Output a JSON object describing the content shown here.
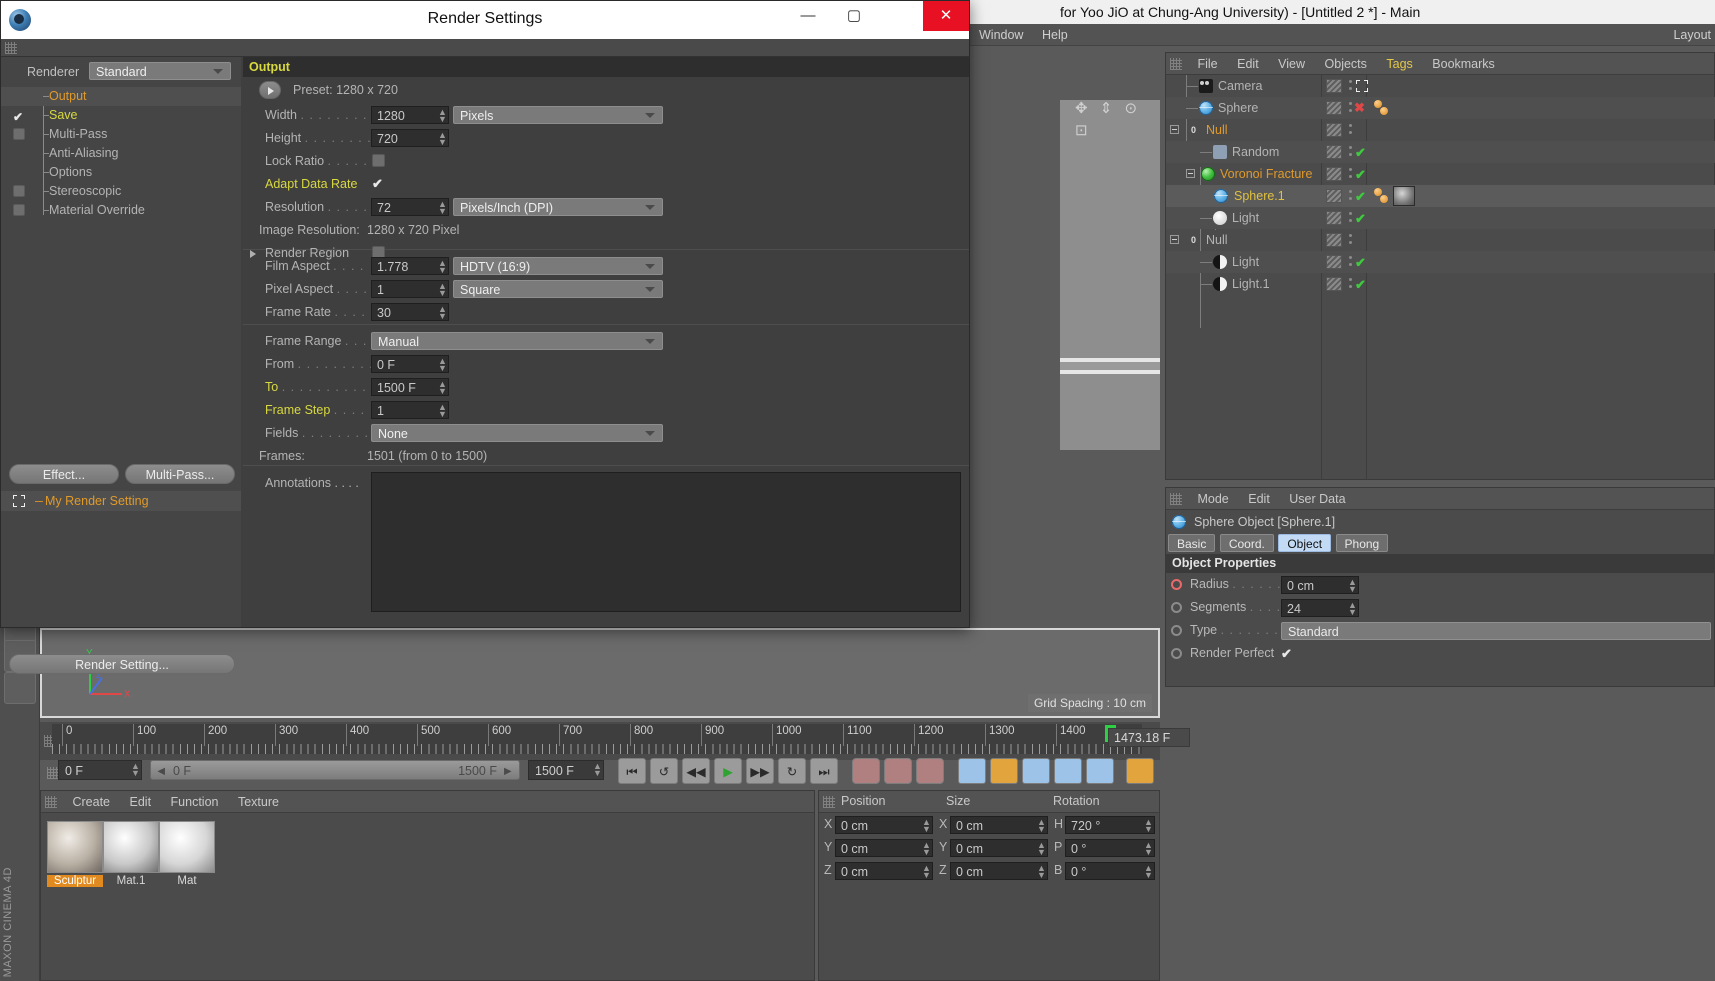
{
  "app": {
    "window_title": "for Yoo JiO at Chung-Ang University) - [Untitled 2 *] - Main",
    "menu": [
      "Window",
      "Help"
    ],
    "layout_label": "Layout"
  },
  "object_manager": {
    "menu": [
      "File",
      "Edit",
      "View",
      "Objects",
      "Tags",
      "Bookmarks"
    ],
    "highlighted_menu": "Tags",
    "rows": [
      {
        "name": "Camera",
        "icon": "camera-icon",
        "color": "gray",
        "indent": 1,
        "state": "axis",
        "materials": []
      },
      {
        "name": "Sphere",
        "icon": "sphere-icon",
        "color": "gray",
        "indent": 1,
        "state": "x",
        "materials": [
          "mat-dot",
          "mat-dot"
        ]
      },
      {
        "name": "Null",
        "icon": "null-icon",
        "color": "orange",
        "indent": 0,
        "state": "none",
        "materials": []
      },
      {
        "name": "Random",
        "icon": "random-icon",
        "color": "gray",
        "indent": 2,
        "state": "check",
        "materials": []
      },
      {
        "name": "Voronoi Fracture",
        "icon": "voronoi-icon",
        "color": "orange",
        "indent": 1,
        "state": "check",
        "materials": []
      },
      {
        "name": "Sphere.1",
        "icon": "sphere-icon",
        "color": "yellow",
        "indent": 3,
        "state": "check",
        "materials": [
          "mat-dot",
          "mat-dot",
          "mat-thumb"
        ]
      },
      {
        "name": "Light",
        "icon": "light-icon",
        "color": "gray",
        "indent": 2,
        "state": "none",
        "materials": []
      },
      {
        "name": "Null",
        "icon": "null-icon",
        "color": "gray",
        "indent": 0,
        "state": "none",
        "materials": []
      },
      {
        "name": "Light",
        "icon": "light2-icon",
        "color": "gray",
        "indent": 2,
        "state": "check",
        "materials": []
      },
      {
        "name": "Light.1",
        "icon": "light2-icon",
        "color": "gray",
        "indent": 2,
        "state": "check",
        "materials": []
      }
    ]
  },
  "attribute_manager": {
    "menu": [
      "Mode",
      "Edit",
      "User Data"
    ],
    "object_title": "Sphere Object [Sphere.1]",
    "tabs": [
      "Basic",
      "Coord.",
      "Object",
      "Phong"
    ],
    "active_tab": "Object",
    "section_title": "Object Properties",
    "props": [
      {
        "label": "Radius",
        "dots": ". . . . . .",
        "value": "0 cm",
        "type": "num",
        "radio": "on"
      },
      {
        "label": "Segments",
        "dots": ". . . .",
        "value": "24",
        "type": "num",
        "radio": "off"
      },
      {
        "label": "Type",
        "dots": ". . . . . . .",
        "value": "Standard",
        "type": "drop",
        "radio": "off"
      },
      {
        "label": "Render Perfect",
        "dots": "",
        "value": "checked",
        "type": "check",
        "radio": "off"
      }
    ]
  },
  "viewport": {
    "grid_spacing_label": "Grid Spacing : 10 cm",
    "axis_labels": {
      "x": "X",
      "y": "Y",
      "z": "Z"
    }
  },
  "timeline": {
    "tick_labels": [
      "0",
      "100",
      "200",
      "300",
      "400",
      "500",
      "600",
      "700",
      "800",
      "900",
      "1000",
      "1100",
      "1200",
      "1300",
      "1400"
    ],
    "tick_values": [
      0,
      100,
      200,
      300,
      400,
      500,
      600,
      700,
      800,
      900,
      1000,
      1100,
      1200,
      1300,
      1400
    ],
    "current_frame_marker": "147",
    "current_frame_field": "1473.18 F",
    "transport": {
      "current_frame": "0 F",
      "range_start": "0 F",
      "range_end": "1500 F",
      "preview_end": "1500 F"
    }
  },
  "material_manager": {
    "menu": [
      "Create",
      "Edit",
      "Function",
      "Texture"
    ],
    "materials": [
      {
        "name": "Sculptur",
        "selected": true
      },
      {
        "name": "Mat.1",
        "selected": false
      },
      {
        "name": "Mat",
        "selected": false
      }
    ]
  },
  "coordinate_manager": {
    "headers": [
      "Position",
      "Size",
      "Rotation"
    ],
    "rows": [
      {
        "axis1": "X",
        "pos": "0 cm",
        "axis2": "X",
        "size": "0 cm",
        "axis3": "H",
        "rot": "720 °"
      },
      {
        "axis1": "Y",
        "pos": "0 cm",
        "axis2": "Y",
        "size": "0 cm",
        "axis3": "P",
        "rot": "0 °"
      },
      {
        "axis1": "Z",
        "pos": "0 cm",
        "axis2": "Z",
        "size": "0 cm",
        "axis3": "B",
        "rot": "0 °"
      }
    ]
  },
  "render_settings": {
    "window_title": "Render Settings",
    "window_buttons": {
      "minimize": "—",
      "maximize": "▢",
      "close": "✕"
    },
    "renderer_label": "Renderer",
    "renderer_value": "Standard",
    "tree": [
      {
        "label": "Output",
        "color": "orange",
        "box": "none"
      },
      {
        "label": "Save",
        "color": "yellow",
        "box": "check"
      },
      {
        "label": "Multi-Pass",
        "color": "gray",
        "box": "empty"
      },
      {
        "label": "Anti-Aliasing",
        "color": "gray",
        "box": "none"
      },
      {
        "label": "Options",
        "color": "gray",
        "box": "none"
      },
      {
        "label": "Stereoscopic",
        "color": "gray",
        "box": "empty"
      },
      {
        "label": "Material Override",
        "color": "gray",
        "box": "empty"
      }
    ],
    "buttons": {
      "effect": "Effect...",
      "multipass": "Multi-Pass...",
      "render_setting": "Render Setting..."
    },
    "my_render_setting": "My Render Setting",
    "panel": {
      "section_title": "Output",
      "preset_label": "Preset: 1280 x 720",
      "fields": [
        {
          "label": "Width",
          "dots": ". . . . . . . .",
          "value": "1280",
          "unit": "Pixels",
          "type": "num-drop",
          "hl": false
        },
        {
          "label": "Height",
          "dots": ". . . . . . . .",
          "value": "720",
          "unit": "",
          "type": "num",
          "hl": false
        },
        {
          "label": "Lock Ratio",
          "dots": ". . . . .",
          "value": "",
          "unit": "",
          "type": "toggle",
          "hl": false
        },
        {
          "label": "Adapt Data Rate",
          "dots": "",
          "value": "checked",
          "unit": "",
          "type": "check",
          "hl": true
        },
        {
          "label": "Resolution",
          "dots": ". . . . .",
          "value": "72",
          "unit": "Pixels/Inch (DPI)",
          "type": "num-drop",
          "hl": false
        }
      ],
      "image_resolution_label": "Image Resolution:",
      "image_resolution_value": "1280 x 720 Pixel",
      "render_region_label": "Render Region",
      "aspect_fields": [
        {
          "label": "Film Aspect",
          "dots": ". . . .",
          "value": "1.778",
          "unit": "HDTV (16:9)",
          "type": "num-drop"
        },
        {
          "label": "Pixel Aspect",
          "dots": ". . . .",
          "value": "1",
          "unit": "Square",
          "type": "num-drop"
        },
        {
          "label": "Frame Rate",
          "dots": ". . . .",
          "value": "30",
          "unit": "",
          "type": "num"
        }
      ],
      "range_fields": [
        {
          "label": "Frame Range",
          "dots": ". . .",
          "value": "Manual",
          "type": "drop",
          "hl": false
        },
        {
          "label": "From",
          "dots": ". . . . . . . . .",
          "value": "0 F",
          "type": "num",
          "hl": false
        },
        {
          "label": "To",
          "dots": ". . . . . . . . . . .",
          "value": "1500 F",
          "type": "num",
          "hl": true
        },
        {
          "label": "Frame Step",
          "dots": ". . . .",
          "value": "1",
          "type": "num",
          "hl": true
        },
        {
          "label": "Fields",
          "dots": ". . . . . . . .",
          "value": "None",
          "type": "drop",
          "hl": false
        }
      ],
      "frames_label": "Frames:",
      "frames_value": "1501 (from 0 to 1500)",
      "annotations_label": "Annotations . . . .",
      "annotations_value": ""
    }
  }
}
